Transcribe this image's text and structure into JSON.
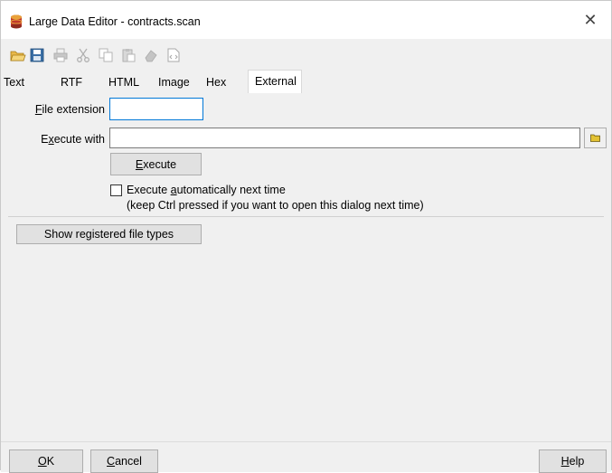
{
  "window": {
    "title": "Large Data Editor - contracts.scan",
    "close_symbol": "✕"
  },
  "toolbar": {
    "items": [
      {
        "name": "open-icon",
        "enabled": true
      },
      {
        "name": "save-icon",
        "enabled": true
      },
      {
        "name": "print-icon",
        "enabled": false
      },
      {
        "name": "cut-icon",
        "enabled": false
      },
      {
        "name": "copy-icon",
        "enabled": false
      },
      {
        "name": "paste-icon",
        "enabled": false
      },
      {
        "name": "eraser-icon",
        "enabled": false
      },
      {
        "name": "code-file-icon",
        "enabled": false
      }
    ]
  },
  "tabs": [
    "Text",
    "RTF",
    "HTML",
    "Image",
    "Hex",
    "External"
  ],
  "active_tab": "External",
  "form": {
    "file_extension_label_key": "F",
    "file_extension_label_rest": "ile extension",
    "file_extension_value": "",
    "execute_with_label_pre": "E",
    "execute_with_label_key": "x",
    "execute_with_label_rest": "ecute with",
    "execute_with_value": "",
    "execute_button_key": "E",
    "execute_button_rest": "xecute",
    "auto_checkbox_pre": "Execute ",
    "auto_checkbox_key": "a",
    "auto_checkbox_rest": "utomatically next time",
    "auto_checked": false,
    "auto_hint": "(keep Ctrl pressed if you want to open this dialog next time)",
    "show_types_button": "Show registered file types"
  },
  "footer": {
    "ok_key": "O",
    "ok_rest": "K",
    "cancel_key": "C",
    "cancel_rest": "ancel",
    "help_key": "H",
    "help_rest": "elp"
  },
  "colors": {
    "accent_focus": "#0078d7",
    "panel_bg": "#f0f0f0",
    "button_bg": "#e1e1e1"
  }
}
